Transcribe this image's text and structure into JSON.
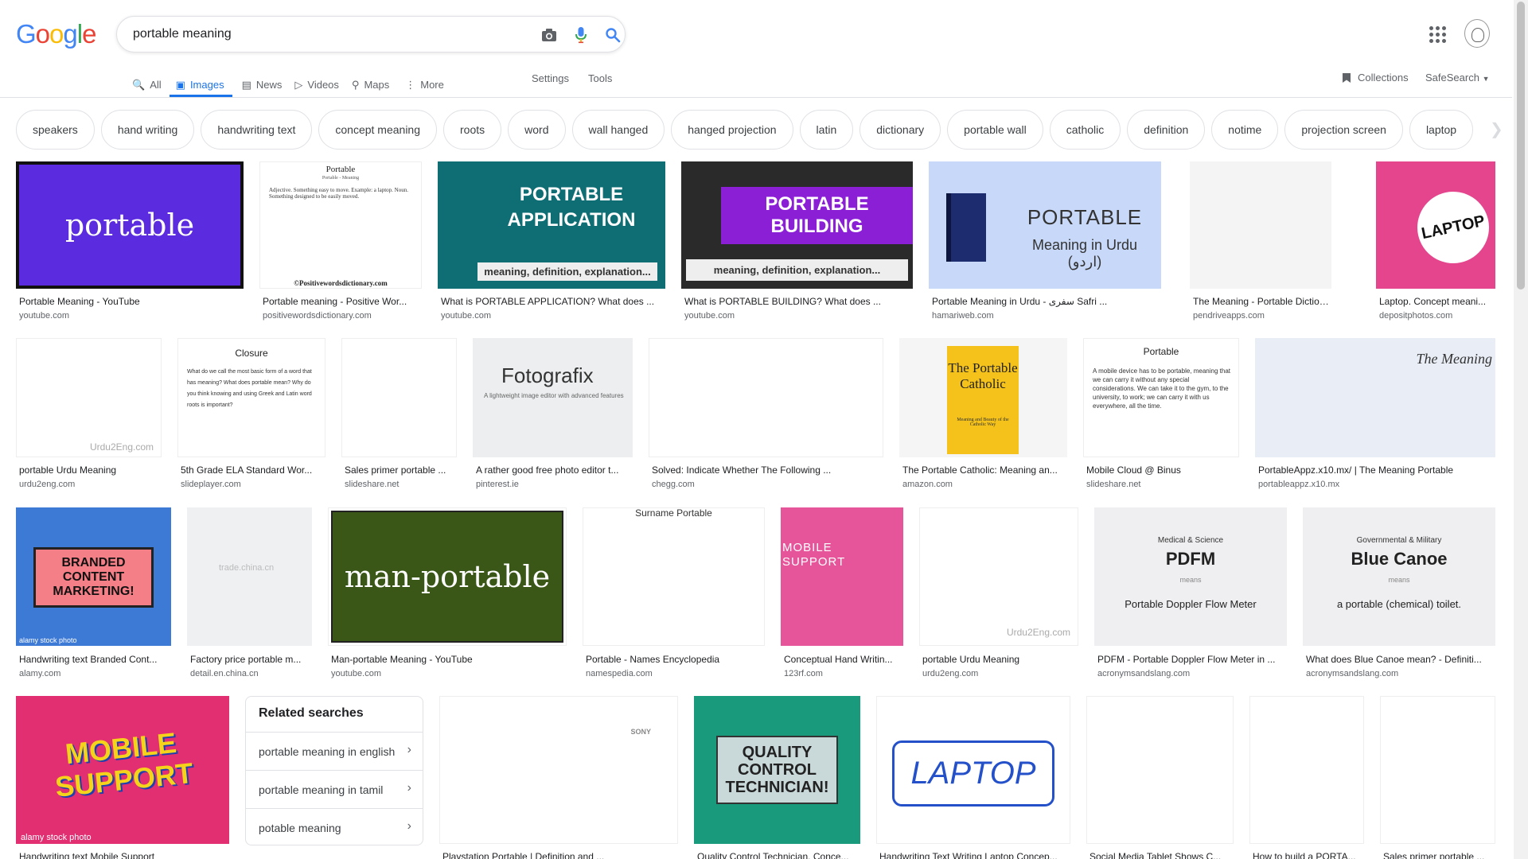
{
  "logo": {
    "text": "Google",
    "colors": [
      "#4285f4",
      "#ea4335",
      "#fbbc05",
      "#4285f4",
      "#34a853",
      "#ea4335"
    ]
  },
  "search": {
    "query": "portable meaning",
    "icons": [
      "camera-icon",
      "microphone-icon",
      "search-icon"
    ]
  },
  "tabs": [
    {
      "label": "All",
      "icon": "search-icon",
      "active": false
    },
    {
      "label": "Images",
      "icon": "image-icon",
      "active": true
    },
    {
      "label": "News",
      "icon": "news-icon",
      "active": false
    },
    {
      "label": "Videos",
      "icon": "play-icon",
      "active": false
    },
    {
      "label": "Maps",
      "icon": "map-pin-icon",
      "active": false
    },
    {
      "label": "More",
      "icon": "more-vert-icon",
      "active": false
    }
  ],
  "tools": {
    "settings": "Settings",
    "tools": "Tools",
    "collections": "Collections",
    "safesearch": "SafeSearch"
  },
  "chips": [
    "speakers",
    "hand writing",
    "handwriting text",
    "concept meaning",
    "roots",
    "word",
    "wall hanged",
    "hanged projection",
    "latin",
    "dictionary",
    "portable wall",
    "catholic",
    "definition",
    "notime",
    "projection screen",
    "laptop"
  ],
  "results": [
    {
      "title": "Portable Meaning - YouTube",
      "source": "youtube.com",
      "thumb_text": "portable"
    },
    {
      "title": "Portable meaning - Positive Wor...",
      "source": "positivewordsdictionary.com",
      "thumb_text": "Portable",
      "thumb_subtext": "Portable - Meaning",
      "thumb_body": "Adjective. Something easy to move. Example: a laptop. Noun. Something designed to be easily moved.",
      "thumb_footer": "©Positivewordsdictionary.com"
    },
    {
      "title": "What is PORTABLE APPLICATION? What does ...",
      "source": "youtube.com",
      "thumb_text": "PORTABLE APPLICATION",
      "thumb_subtext": "meaning, definition, explanation..."
    },
    {
      "title": "What is PORTABLE BUILDING? What does ...",
      "source": "youtube.com",
      "thumb_text": "PORTABLE BUILDING",
      "thumb_subtext": "meaning, definition, explanation..."
    },
    {
      "title": "Portable Meaning in Urdu - سفری Safri ...",
      "source": "hamariweb.com",
      "thumb_text": "PORTABLE",
      "thumb_subtext": "Meaning in Urdu (اردو)"
    },
    {
      "title": "The Meaning - Portable Dictionary ...",
      "source": "pendriveapps.com",
      "thumb_text": ""
    },
    {
      "title": "Laptop. Concept meani...",
      "source": "depositphotos.com",
      "thumb_text": "LAPTOP"
    },
    {
      "title": "portable Urdu Meaning",
      "source": "urdu2eng.com",
      "thumb_text": "Urdu2Eng.com"
    },
    {
      "title": "5th Grade ELA Standard Wor...",
      "source": "slideplayer.com",
      "thumb_text": "Closure",
      "thumb_body": "What do we call the most basic form of a word that has meaning? What does portable mean? Why do you think knowing and using Greek and Latin word roots is important?"
    },
    {
      "title": "Sales primer portable ...",
      "source": "slideshare.net",
      "thumb_text": ""
    },
    {
      "title": "A rather good free photo editor t...",
      "source": "pinterest.ie",
      "thumb_text": "Fotografix",
      "thumb_subtext": "A lightweight image editor with advanced features"
    },
    {
      "title": "Solved: Indicate Whether The Following ...",
      "source": "chegg.com",
      "thumb_text": ""
    },
    {
      "title": "The Portable Catholic: Meaning an...",
      "source": "amazon.com",
      "thumb_text": "The Portable Catholic",
      "thumb_subtext": "Meaning and Beauty of the Catholic Way"
    },
    {
      "title": "Mobile Cloud @ Binus",
      "source": "slideshare.net",
      "thumb_text": "Portable",
      "thumb_body": "A mobile device has to be portable, meaning that we can carry it without any special considerations. We can take it to the gym, to the university, to work; we can carry it with us everywhere, all the time."
    },
    {
      "title": "PortableAppz.x10.mx/ | The Meaning Portable",
      "source": "portableappz.x10.mx",
      "thumb_text": "The Meaning"
    },
    {
      "title": "Handwriting text Branded Cont...",
      "source": "alamy.com",
      "thumb_text": "BRANDED CONTENT MARKETING!",
      "thumb_footer": "alamy stock photo"
    },
    {
      "title": "Factory price portable m...",
      "source": "detail.en.china.cn",
      "thumb_text": "trade.china.cn"
    },
    {
      "title": "Man-portable Meaning - YouTube",
      "source": "youtube.com",
      "thumb_text": "man-portable"
    },
    {
      "title": "Portable - Names Encyclopedia",
      "source": "namespedia.com",
      "thumb_text": "Surname Portable"
    },
    {
      "title": "Conceptual Hand Writin...",
      "source": "123rf.com",
      "thumb_text": "MOBILE SUPPORT"
    },
    {
      "title": "portable Urdu Meaning",
      "source": "urdu2eng.com",
      "thumb_text": "Urdu2Eng.com"
    },
    {
      "title": "PDFM - Portable Doppler Flow Meter in ...",
      "source": "acronymsandslang.com",
      "thumb_text": "PDFM",
      "thumb_subtext": "Medical & Science",
      "thumb_body": "Portable Doppler Flow Meter",
      "thumb_mid": "means"
    },
    {
      "title": "What does Blue Canoe mean? - Definiti...",
      "source": "acronymsandslang.com",
      "thumb_text": "Blue Canoe",
      "thumb_subtext": "Governmental & Military",
      "thumb_body": "a portable (chemical) toilet.",
      "thumb_mid": "means"
    },
    {
      "title": "Handwriting text Mobile Support",
      "source": "",
      "thumb_text": "MOBILE SUPPORT",
      "thumb_footer": "alamy stock photo"
    },
    {
      "title": "Playstation Portable | Definition and ...",
      "source": "",
      "thumb_text": "SONY"
    },
    {
      "title": "Quality Control Technician. Conce...",
      "source": "",
      "thumb_text": "QUALITY CONTROL TECHNICIAN!"
    },
    {
      "title": "Handwriting Text Writing Laptop Concep...",
      "source": "",
      "thumb_text": "LAPTOP"
    },
    {
      "title": "Social Media Tablet Shows C...",
      "source": "",
      "thumb_text": ""
    },
    {
      "title": "How to build a PORTA...",
      "source": "",
      "thumb_text": ""
    },
    {
      "title": "Sales primer portable ...",
      "source": "",
      "thumb_text": ""
    }
  ],
  "related": {
    "title": "Related searches",
    "items": [
      "portable meaning in english",
      "portable meaning in tamil",
      "potable meaning"
    ]
  }
}
